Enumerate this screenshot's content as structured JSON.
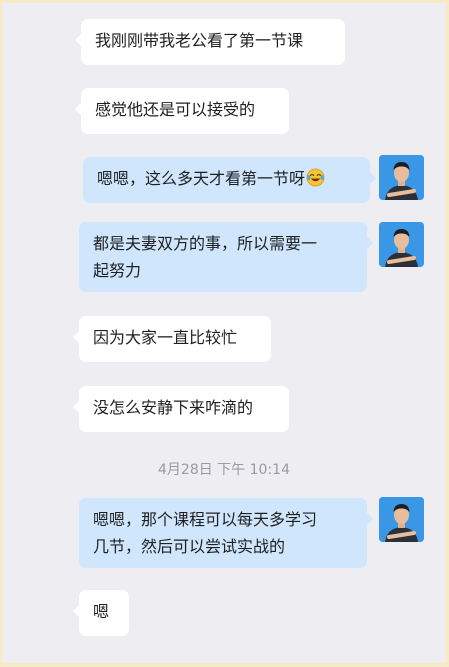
{
  "messages": [
    {
      "side": "left",
      "text": "我刚刚带我老公看了第一节课"
    },
    {
      "side": "left",
      "text": "感觉他还是可以接受的"
    },
    {
      "side": "right",
      "text": "嗯嗯，这么多天才看第一节呀",
      "emoji": "laughing-tears-emoji"
    },
    {
      "side": "right",
      "line1": "都是夫妻双方的事，所以需要一",
      "line2": "起努力"
    },
    {
      "side": "left",
      "text": "因为大家一直比较忙"
    },
    {
      "side": "left",
      "text": "没怎么安静下来咋滴的"
    },
    {
      "side": "right",
      "line1": "嗯嗯，那个课程可以每天多学习",
      "line2": "几节，然后可以尝试实战的"
    },
    {
      "side": "left",
      "text": "嗯"
    }
  ],
  "timestamp": "4月28日  下午 10:14",
  "avatar_icon": "coach-avatar",
  "colors": {
    "background": "#ededf2",
    "left_bubble": "#ffffff",
    "right_bubble": "#cfe6fd",
    "outer_frame": "#f5ebc9"
  }
}
